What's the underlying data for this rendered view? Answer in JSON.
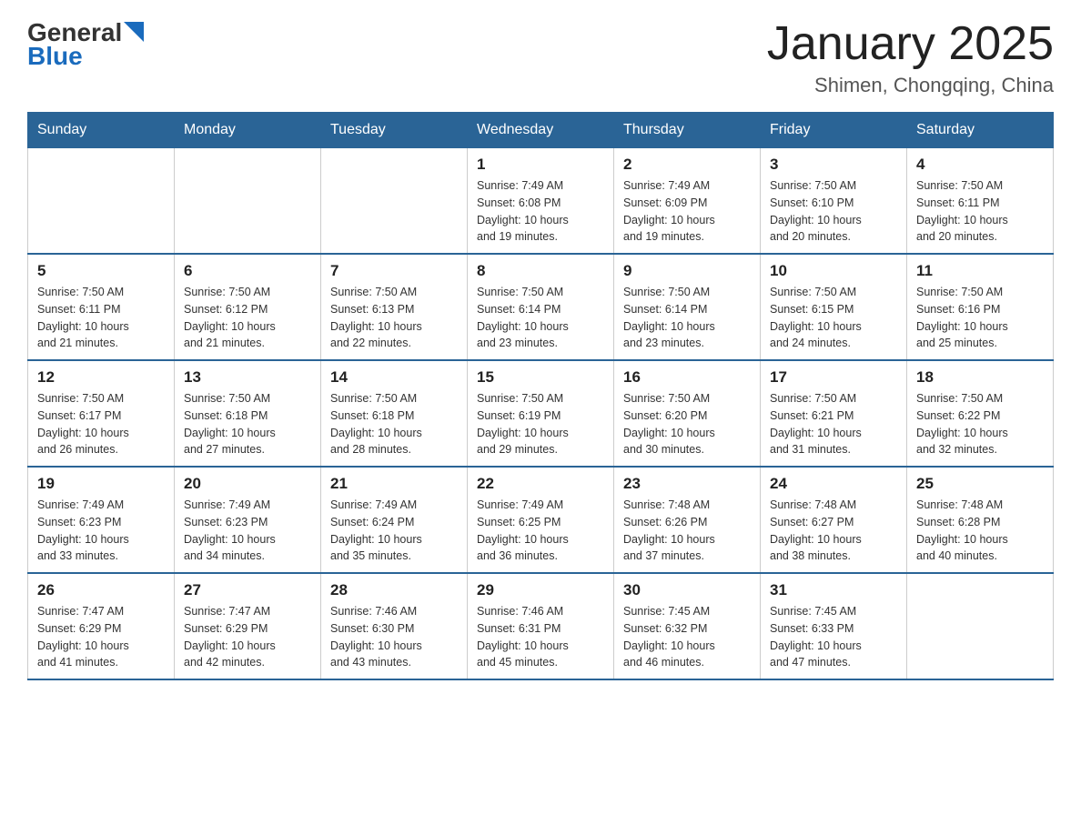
{
  "header": {
    "logo_general": "General",
    "logo_blue": "Blue",
    "month_year": "January 2025",
    "location": "Shimen, Chongqing, China"
  },
  "days_of_week": [
    "Sunday",
    "Monday",
    "Tuesday",
    "Wednesday",
    "Thursday",
    "Friday",
    "Saturday"
  ],
  "weeks": [
    [
      {
        "day": "",
        "info": ""
      },
      {
        "day": "",
        "info": ""
      },
      {
        "day": "",
        "info": ""
      },
      {
        "day": "1",
        "info": "Sunrise: 7:49 AM\nSunset: 6:08 PM\nDaylight: 10 hours\nand 19 minutes."
      },
      {
        "day": "2",
        "info": "Sunrise: 7:49 AM\nSunset: 6:09 PM\nDaylight: 10 hours\nand 19 minutes."
      },
      {
        "day": "3",
        "info": "Sunrise: 7:50 AM\nSunset: 6:10 PM\nDaylight: 10 hours\nand 20 minutes."
      },
      {
        "day": "4",
        "info": "Sunrise: 7:50 AM\nSunset: 6:11 PM\nDaylight: 10 hours\nand 20 minutes."
      }
    ],
    [
      {
        "day": "5",
        "info": "Sunrise: 7:50 AM\nSunset: 6:11 PM\nDaylight: 10 hours\nand 21 minutes."
      },
      {
        "day": "6",
        "info": "Sunrise: 7:50 AM\nSunset: 6:12 PM\nDaylight: 10 hours\nand 21 minutes."
      },
      {
        "day": "7",
        "info": "Sunrise: 7:50 AM\nSunset: 6:13 PM\nDaylight: 10 hours\nand 22 minutes."
      },
      {
        "day": "8",
        "info": "Sunrise: 7:50 AM\nSunset: 6:14 PM\nDaylight: 10 hours\nand 23 minutes."
      },
      {
        "day": "9",
        "info": "Sunrise: 7:50 AM\nSunset: 6:14 PM\nDaylight: 10 hours\nand 23 minutes."
      },
      {
        "day": "10",
        "info": "Sunrise: 7:50 AM\nSunset: 6:15 PM\nDaylight: 10 hours\nand 24 minutes."
      },
      {
        "day": "11",
        "info": "Sunrise: 7:50 AM\nSunset: 6:16 PM\nDaylight: 10 hours\nand 25 minutes."
      }
    ],
    [
      {
        "day": "12",
        "info": "Sunrise: 7:50 AM\nSunset: 6:17 PM\nDaylight: 10 hours\nand 26 minutes."
      },
      {
        "day": "13",
        "info": "Sunrise: 7:50 AM\nSunset: 6:18 PM\nDaylight: 10 hours\nand 27 minutes."
      },
      {
        "day": "14",
        "info": "Sunrise: 7:50 AM\nSunset: 6:18 PM\nDaylight: 10 hours\nand 28 minutes."
      },
      {
        "day": "15",
        "info": "Sunrise: 7:50 AM\nSunset: 6:19 PM\nDaylight: 10 hours\nand 29 minutes."
      },
      {
        "day": "16",
        "info": "Sunrise: 7:50 AM\nSunset: 6:20 PM\nDaylight: 10 hours\nand 30 minutes."
      },
      {
        "day": "17",
        "info": "Sunrise: 7:50 AM\nSunset: 6:21 PM\nDaylight: 10 hours\nand 31 minutes."
      },
      {
        "day": "18",
        "info": "Sunrise: 7:50 AM\nSunset: 6:22 PM\nDaylight: 10 hours\nand 32 minutes."
      }
    ],
    [
      {
        "day": "19",
        "info": "Sunrise: 7:49 AM\nSunset: 6:23 PM\nDaylight: 10 hours\nand 33 minutes."
      },
      {
        "day": "20",
        "info": "Sunrise: 7:49 AM\nSunset: 6:23 PM\nDaylight: 10 hours\nand 34 minutes."
      },
      {
        "day": "21",
        "info": "Sunrise: 7:49 AM\nSunset: 6:24 PM\nDaylight: 10 hours\nand 35 minutes."
      },
      {
        "day": "22",
        "info": "Sunrise: 7:49 AM\nSunset: 6:25 PM\nDaylight: 10 hours\nand 36 minutes."
      },
      {
        "day": "23",
        "info": "Sunrise: 7:48 AM\nSunset: 6:26 PM\nDaylight: 10 hours\nand 37 minutes."
      },
      {
        "day": "24",
        "info": "Sunrise: 7:48 AM\nSunset: 6:27 PM\nDaylight: 10 hours\nand 38 minutes."
      },
      {
        "day": "25",
        "info": "Sunrise: 7:48 AM\nSunset: 6:28 PM\nDaylight: 10 hours\nand 40 minutes."
      }
    ],
    [
      {
        "day": "26",
        "info": "Sunrise: 7:47 AM\nSunset: 6:29 PM\nDaylight: 10 hours\nand 41 minutes."
      },
      {
        "day": "27",
        "info": "Sunrise: 7:47 AM\nSunset: 6:29 PM\nDaylight: 10 hours\nand 42 minutes."
      },
      {
        "day": "28",
        "info": "Sunrise: 7:46 AM\nSunset: 6:30 PM\nDaylight: 10 hours\nand 43 minutes."
      },
      {
        "day": "29",
        "info": "Sunrise: 7:46 AM\nSunset: 6:31 PM\nDaylight: 10 hours\nand 45 minutes."
      },
      {
        "day": "30",
        "info": "Sunrise: 7:45 AM\nSunset: 6:32 PM\nDaylight: 10 hours\nand 46 minutes."
      },
      {
        "day": "31",
        "info": "Sunrise: 7:45 AM\nSunset: 6:33 PM\nDaylight: 10 hours\nand 47 minutes."
      },
      {
        "day": "",
        "info": ""
      }
    ]
  ]
}
